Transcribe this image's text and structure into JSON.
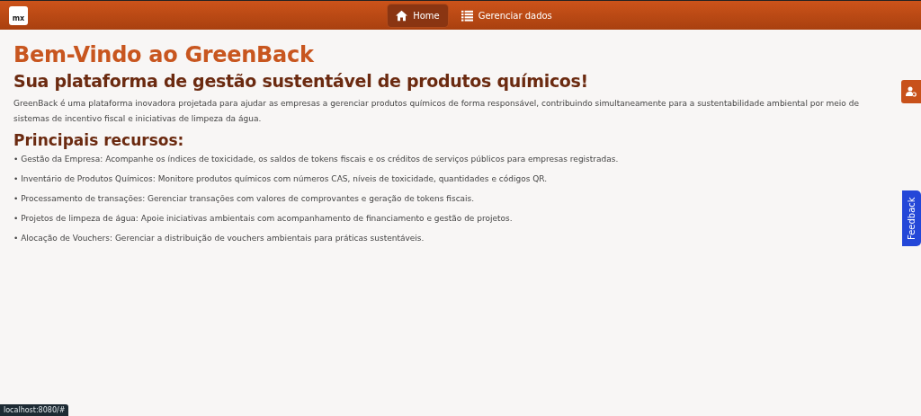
{
  "header": {
    "logo": "mx",
    "nav": [
      {
        "label": "Home",
        "kind": "home",
        "selected": true
      },
      {
        "label": "Gerenciar dados",
        "kind": "list",
        "selected": false
      }
    ]
  },
  "main": {
    "title": "Bem-Vindo ao GreenBack",
    "subtitle": "Sua plataforma de gestão sustentável de produtos químicos!",
    "intro": "GreenBack é uma plataforma inovadora projetada para ajudar as empresas a gerenciar produtos químicos de forma responsável, contribuindo simultaneamente para a sustentabilidade ambiental por meio de sistemas de incentivo fiscal e iniciativas de limpeza da água.",
    "features_heading": "Principais recursos:",
    "features": [
      "• Gestão da Empresa: Acompanhe os índices de toxicidade, os saldos de tokens fiscais e os créditos de serviços públicos para empresas registradas.",
      "• Inventário de Produtos Químicos: Monitore produtos químicos com números CAS, níveis de toxicidade, quantidades e códigos QR.",
      "• Processamento de transações: Gerenciar transações com valores de comprovantes e geração de tokens fiscais.",
      "• Projetos de limpeza de água: Apoie iniciativas ambientais com acompanhamento de financiamento e gestão de projetos.",
      "• Alocação de Vouchers: Gerenciar a distribuição de vouchers ambientais para práticas sustentáveis."
    ]
  },
  "feedback_tab": "Feedback",
  "status_bar": "localhost:8080/#"
}
